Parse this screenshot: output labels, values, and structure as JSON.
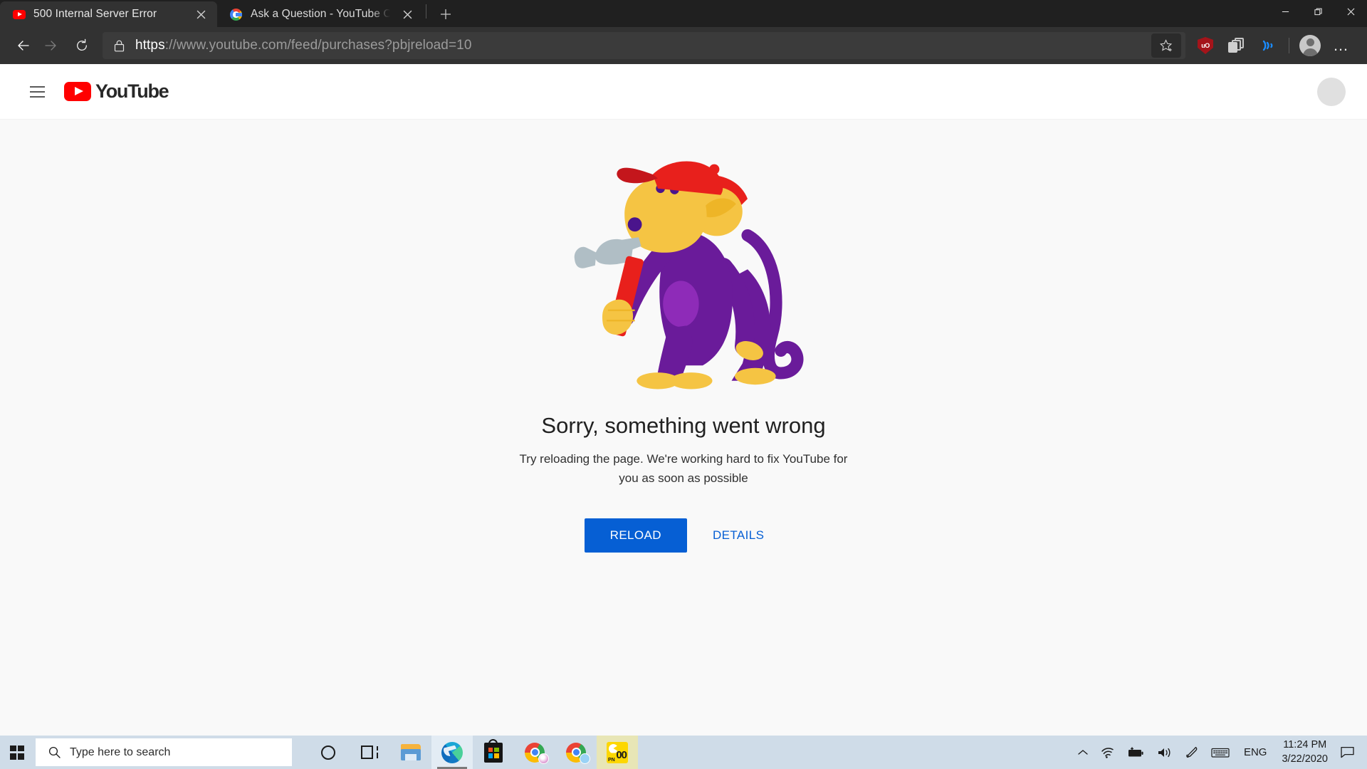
{
  "browser": {
    "tabs": [
      {
        "title": "500 Internal Server Error",
        "favicon": "youtube-icon",
        "active": true
      },
      {
        "title": "Ask a Question - YouTube Comm",
        "favicon": "google-icon",
        "active": false
      }
    ],
    "new_tab_label": "+",
    "window_controls": {
      "minimize": "minimize-icon",
      "restore": "restore-icon",
      "close": "close-icon"
    },
    "nav": {
      "back": "back-arrow-icon",
      "forward": "forward-arrow-icon",
      "refresh": "refresh-icon"
    },
    "address_bar": {
      "lock": "padlock-icon",
      "url_scheme": "https",
      "url_host": "://www.youtube.com",
      "url_path": "/feed/purchases?pbjreload=10",
      "favorite": "star-add-icon"
    },
    "toolbar_icons": [
      {
        "name": "ublock-origin-icon",
        "label": "uO"
      },
      {
        "name": "collections-icon"
      },
      {
        "name": "read-aloud-icon"
      },
      {
        "name": "profile-avatar"
      },
      {
        "name": "settings-and-more-icon",
        "label": "…"
      }
    ]
  },
  "page": {
    "header": {
      "menu_icon": "hamburger-menu-icon",
      "logo_text": "YouTube",
      "avatar": "account-avatar"
    },
    "error": {
      "illustration": "broken-monkey-with-hammer",
      "title": "Sorry, something went wrong",
      "subtitle": "Try reloading the page. We're working hard to fix YouTube for you as soon as possible",
      "reload_label": "RELOAD",
      "details_label": "DETAILS"
    },
    "colors": {
      "accent": "#065fd4",
      "brand_red": "#ff0000",
      "background": "#f9f9f9"
    }
  },
  "taskbar": {
    "start": "windows-start-icon",
    "search_placeholder": "Type here to search",
    "search_icon": "search-icon",
    "apps": [
      {
        "name": "cortana-icon"
      },
      {
        "name": "task-view-icon"
      },
      {
        "name": "file-explorer-icon"
      },
      {
        "name": "microsoft-edge-icon",
        "active": true
      },
      {
        "name": "microsoft-store-icon"
      },
      {
        "name": "google-chrome-icon"
      },
      {
        "name": "google-chrome-icon"
      },
      {
        "name": "pac-app-icon",
        "label": "00",
        "sublabel": "PN"
      }
    ],
    "tray": {
      "overflow": "chevron-up-icon",
      "network": "wifi-icon",
      "battery": "battery-charging-icon",
      "volume": "speaker-icon",
      "pen": "windows-ink-icon",
      "keyboard": "touch-keyboard-icon",
      "language": "ENG",
      "time": "11:24 PM",
      "date": "3/22/2020",
      "notifications": "action-center-icon"
    }
  }
}
